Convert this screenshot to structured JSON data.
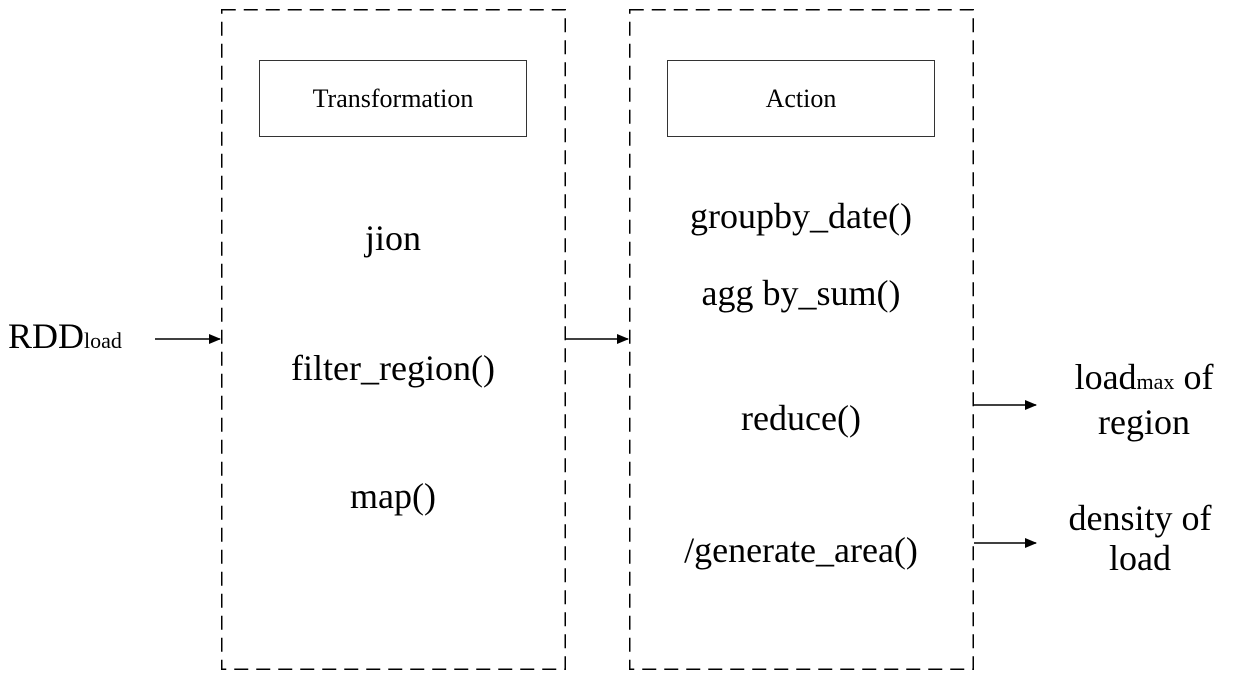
{
  "diagram": {
    "input": {
      "main": "RDD",
      "subscript": "load"
    },
    "transformation": {
      "header": "Transformation",
      "operations": [
        "jion",
        "filter_region()",
        "map()"
      ]
    },
    "action": {
      "header": "Action",
      "operations": [
        "groupby_date()",
        "agg by_sum()",
        "reduce()",
        "/generate_area()"
      ]
    },
    "outputs": [
      {
        "line1_main": "load",
        "line1_subscript": "max",
        "line1_suffix": " of",
        "line2": "region"
      },
      {
        "line1_main": "density of",
        "line2": "load"
      }
    ],
    "colors": {
      "stroke": "#000000",
      "header_border": "#333333",
      "background": "#ffffff"
    }
  }
}
